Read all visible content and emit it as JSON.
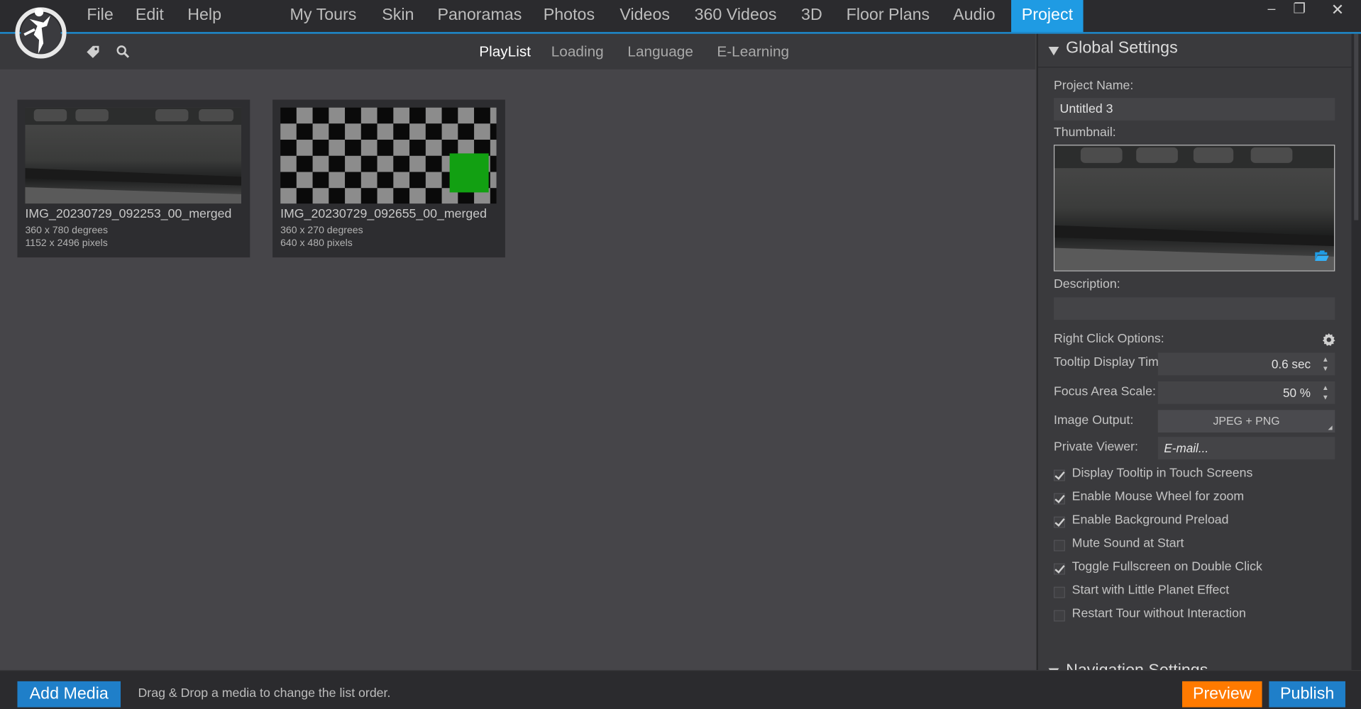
{
  "menu": {
    "file": "File",
    "edit": "Edit",
    "help": "Help"
  },
  "nav": [
    "My Tours",
    "Skin",
    "Panoramas",
    "Photos",
    "Videos",
    "360 Videos",
    "3D",
    "Floor Plans",
    "Audio",
    "Project"
  ],
  "nav_active": "Project",
  "window_controls": {
    "minimize": "–",
    "restore": "❐",
    "close": "✕"
  },
  "toolbar_icons": [
    "tag-icon",
    "search-icon"
  ],
  "subtabs": [
    "PlayList",
    "Loading",
    "Language",
    "E-Learning"
  ],
  "subtab_active": "PlayList",
  "playlist": [
    {
      "name": "IMG_20230729_092253_00_merged",
      "degrees": "360 x 780 degrees",
      "pixels": "1152 x 2496 pixels"
    },
    {
      "name": "IMG_20230729_092655_00_merged",
      "degrees": "360 x 270 degrees",
      "pixels": "640 x 480 pixels"
    }
  ],
  "panel": {
    "title": "Global Settings",
    "project_name_label": "Project Name:",
    "project_name_value": "Untitled 3",
    "thumbnail_label": "Thumbnail:",
    "description_label": "Description:",
    "description_value": "",
    "right_click_label": "Right Click Options:",
    "tooltip_time_label": "Tooltip Display Time:",
    "tooltip_time_value": "0.6 sec",
    "focus_scale_label": "Focus Area Scale:",
    "focus_scale_value": "50 %",
    "image_output_label": "Image Output:",
    "image_output_value": "JPEG + PNG",
    "private_viewer_label": "Private Viewer:",
    "private_viewer_placeholder": "E-mail...",
    "checkboxes": [
      {
        "label": "Display Tooltip in Touch Screens",
        "checked": true
      },
      {
        "label": "Enable Mouse Wheel for zoom",
        "checked": true
      },
      {
        "label": "Enable Background Preload",
        "checked": true
      },
      {
        "label": "Mute Sound at Start",
        "checked": false
      },
      {
        "label": "Toggle Fullscreen on Double Click",
        "checked": true
      },
      {
        "label": "Start with Little Planet Effect",
        "checked": false
      },
      {
        "label": "Restart Tour without Interaction",
        "checked": false
      }
    ],
    "next_section": "Navigation Settings"
  },
  "bottom": {
    "add_media": "Add Media",
    "hint": "Drag & Drop a media to change the list order.",
    "preview": "Preview",
    "publish": "Publish"
  },
  "colors": {
    "accent": "#1f9be3",
    "preview": "#ff7a00",
    "publish": "#1f7fc9",
    "green_tile": "#12a012"
  }
}
